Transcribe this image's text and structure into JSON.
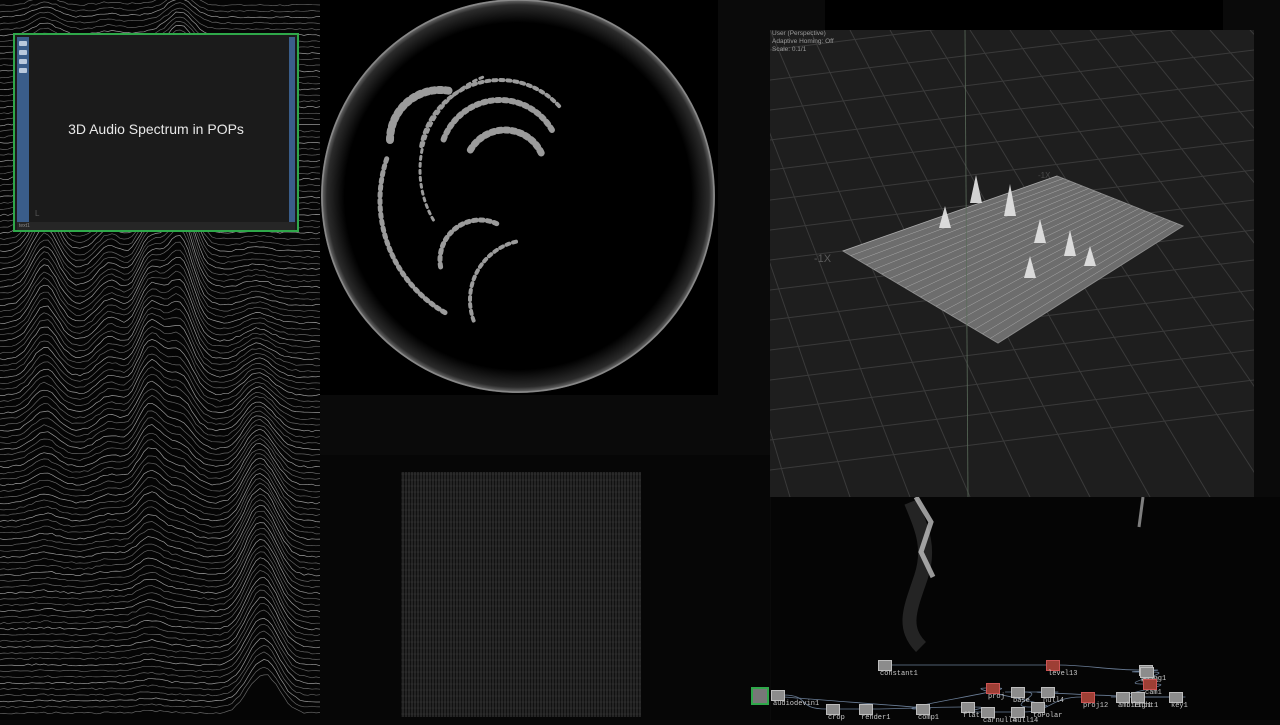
{
  "text_viewer": {
    "title": "3D Audio Spectrum in POPs",
    "footer_label": "text1",
    "axis_label": "L"
  },
  "viewport": {
    "camera": "User (Perspective)",
    "homing": "Adaptive Homing: Off",
    "scale": "Scale: 0.1/1",
    "axis_x_label": "-1X",
    "axis_x2_label": "-1X"
  },
  "network": {
    "nodes": [
      "constant1",
      "level13",
      "phong1",
      "geo1",
      "cam1",
      "light1",
      "key1",
      "ambient1",
      "null4",
      "base",
      "toPolar",
      "proj",
      "comp1",
      "audiodevin1",
      "crop",
      "render1",
      "flat",
      "carnull4",
      "null14",
      "proj12"
    ]
  },
  "colors": {
    "selection_green": "#2fa84a",
    "viewer_strip_blue": "#3a5d8a",
    "node_grey": "#8c8c8c",
    "node_red": "#9e3f35"
  }
}
